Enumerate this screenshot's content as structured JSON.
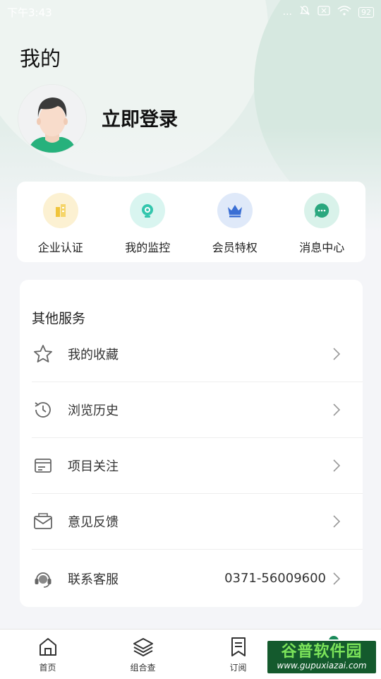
{
  "status_bar": {
    "time": "下午3:43",
    "dots": "...",
    "battery": "92"
  },
  "header": {
    "title": "我的",
    "login_text": "立即登录"
  },
  "quick_actions": [
    {
      "label": "企业认证",
      "icon": "enterprise-building-icon",
      "bg": "#fcf1d2",
      "color": "#f0c43a"
    },
    {
      "label": "我的监控",
      "icon": "camera-monitor-icon",
      "bg": "#d9f5f0",
      "color": "#33c6ad"
    },
    {
      "label": "会员特权",
      "icon": "crown-icon",
      "bg": "#dfe9f9",
      "color": "#3b6fd4"
    },
    {
      "label": "消息中心",
      "icon": "message-bubble-icon",
      "bg": "#d9f2ea",
      "color": "#2aa77e"
    }
  ],
  "services": {
    "title": "其他服务",
    "items": [
      {
        "label": "我的收藏",
        "icon": "star-icon",
        "value": ""
      },
      {
        "label": "浏览历史",
        "icon": "history-clock-icon",
        "value": ""
      },
      {
        "label": "项目关注",
        "icon": "project-list-icon",
        "value": ""
      },
      {
        "label": "意见反馈",
        "icon": "feedback-mail-icon",
        "value": ""
      },
      {
        "label": "联系客服",
        "icon": "customer-service-icon",
        "value": "0371-56009600"
      }
    ]
  },
  "tabbar": [
    {
      "label": "首页",
      "icon": "home-icon"
    },
    {
      "label": "组合查",
      "icon": "layers-icon"
    },
    {
      "label": "订阅",
      "icon": "bookmark-icon"
    }
  ],
  "watermark": {
    "main": "谷普软件园",
    "url": "www.gupuxiazai.com"
  },
  "colors": {
    "accent": "#2aa77e",
    "background": "#f4f5f8"
  }
}
